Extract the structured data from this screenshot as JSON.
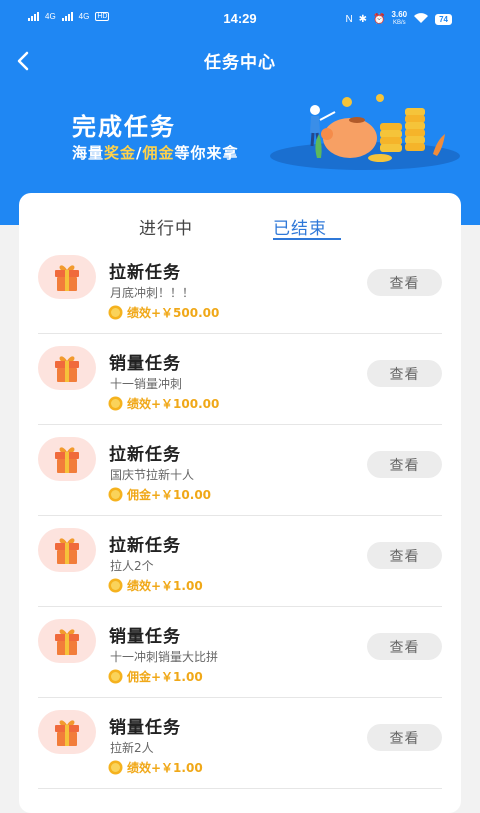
{
  "status_bar": {
    "net1": "4G",
    "net2": "4G",
    "hd": "HD",
    "time": "14:29",
    "speed_value": "3.60",
    "speed_unit": "KB/s",
    "battery": "74"
  },
  "nav": {
    "title": "任务中心"
  },
  "banner": {
    "title": "完成任务",
    "sub_pre": "海量",
    "sub_hl1": "奖金",
    "sub_sep": "/",
    "sub_hl2": "佣金",
    "sub_post": "等你来拿"
  },
  "tabs": [
    {
      "label": "进行中",
      "active": false
    },
    {
      "label": "已结束",
      "active": true
    }
  ],
  "tasks": [
    {
      "title": "拉新任务",
      "desc": "月底冲刺！！！",
      "reward": "绩效+￥500.00",
      "button": "查看"
    },
    {
      "title": "销量任务",
      "desc": "十一销量冲刺",
      "reward": "绩效+￥100.00",
      "button": "查看"
    },
    {
      "title": "拉新任务",
      "desc": "国庆节拉新十人",
      "reward": "佣金+￥10.00",
      "button": "查看"
    },
    {
      "title": "拉新任务",
      "desc": "拉人2个",
      "reward": "绩效+￥1.00",
      "button": "查看"
    },
    {
      "title": "销量任务",
      "desc": "十一冲刺销量大比拼",
      "reward": "佣金+￥1.00",
      "button": "查看"
    },
    {
      "title": "销量任务",
      "desc": "拉新2人",
      "reward": "绩效+￥1.00",
      "button": "查看"
    }
  ],
  "colors": {
    "primary": "#1f87f3",
    "tab_active": "#2f78d8",
    "reward": "#f0a818",
    "gift_bg": "#fde3de"
  },
  "icons": {
    "back": "chevron-left-icon",
    "gift": "gift-icon",
    "coin": "coin-icon"
  }
}
